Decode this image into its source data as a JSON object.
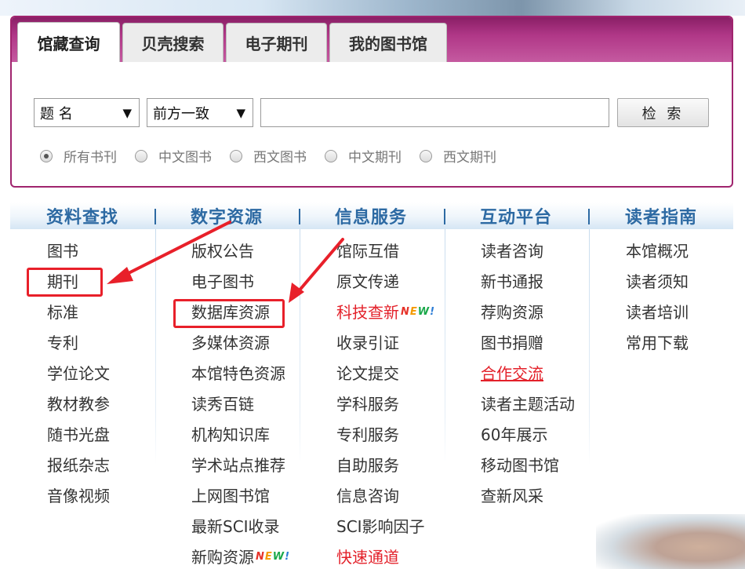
{
  "tabs": [
    {
      "label": "馆藏查询",
      "active": true
    },
    {
      "label": "贝壳搜索",
      "active": false
    },
    {
      "label": "电子期刊",
      "active": false
    },
    {
      "label": "我的图书馆",
      "active": false
    }
  ],
  "search": {
    "field_select": "题 名",
    "match_select": "前方一致",
    "query_value": "",
    "button_label": "检 索",
    "radios": [
      {
        "label": "所有书刊",
        "checked": true
      },
      {
        "label": "中文图书",
        "checked": false
      },
      {
        "label": "西文图书",
        "checked": false
      },
      {
        "label": "中文期刊",
        "checked": false
      },
      {
        "label": "西文期刊",
        "checked": false
      }
    ]
  },
  "nav": {
    "columns": [
      {
        "title": "资料查找",
        "items": [
          {
            "label": "图书"
          },
          {
            "label": "期刊",
            "highlighted": true
          },
          {
            "label": "标准"
          },
          {
            "label": "专利"
          },
          {
            "label": "学位论文"
          },
          {
            "label": "教材教参"
          },
          {
            "label": "随书光盘"
          },
          {
            "label": "报纸杂志"
          },
          {
            "label": "音像视频"
          }
        ]
      },
      {
        "title": "数字资源",
        "items": [
          {
            "label": "版权公告"
          },
          {
            "label": "电子图书"
          },
          {
            "label": "数据库资源",
            "highlighted": true
          },
          {
            "label": "多媒体资源"
          },
          {
            "label": "本馆特色资源"
          },
          {
            "label": "读秀百链"
          },
          {
            "label": "机构知识库"
          },
          {
            "label": "学术站点推荐"
          },
          {
            "label": "上网图书馆"
          },
          {
            "label": "最新SCI收录"
          },
          {
            "label": "新购资源",
            "badge": "NEW!"
          }
        ]
      },
      {
        "title": "信息服务",
        "items": [
          {
            "label": "馆际互借"
          },
          {
            "label": "原文传递"
          },
          {
            "label": "科技查新",
            "color": "red",
            "badge": "NEW!"
          },
          {
            "label": "收录引证"
          },
          {
            "label": "论文提交"
          },
          {
            "label": "学科服务"
          },
          {
            "label": "专利服务"
          },
          {
            "label": "自助服务"
          },
          {
            "label": "信息咨询"
          },
          {
            "label": "SCI影响因子"
          },
          {
            "label": "快速通道",
            "color": "red"
          }
        ]
      },
      {
        "title": "互动平台",
        "items": [
          {
            "label": "读者咨询"
          },
          {
            "label": "新书通报"
          },
          {
            "label": "荐购资源"
          },
          {
            "label": "图书捐赠"
          },
          {
            "label": "合作交流",
            "color": "red",
            "underline": true
          },
          {
            "label": "读者主题活动"
          },
          {
            "label": "60年展示"
          },
          {
            "label": "移动图书馆"
          },
          {
            "label": "查新风采"
          }
        ]
      },
      {
        "title": "读者指南",
        "items": [
          {
            "label": "本馆概况"
          },
          {
            "label": "读者须知"
          },
          {
            "label": "读者培训"
          },
          {
            "label": "常用下载"
          }
        ]
      }
    ]
  },
  "colors": {
    "tab_bar": "#b03787",
    "nav_title": "#2d6aa3",
    "highlight": "#e8202a",
    "red_link": "#e3212a"
  }
}
